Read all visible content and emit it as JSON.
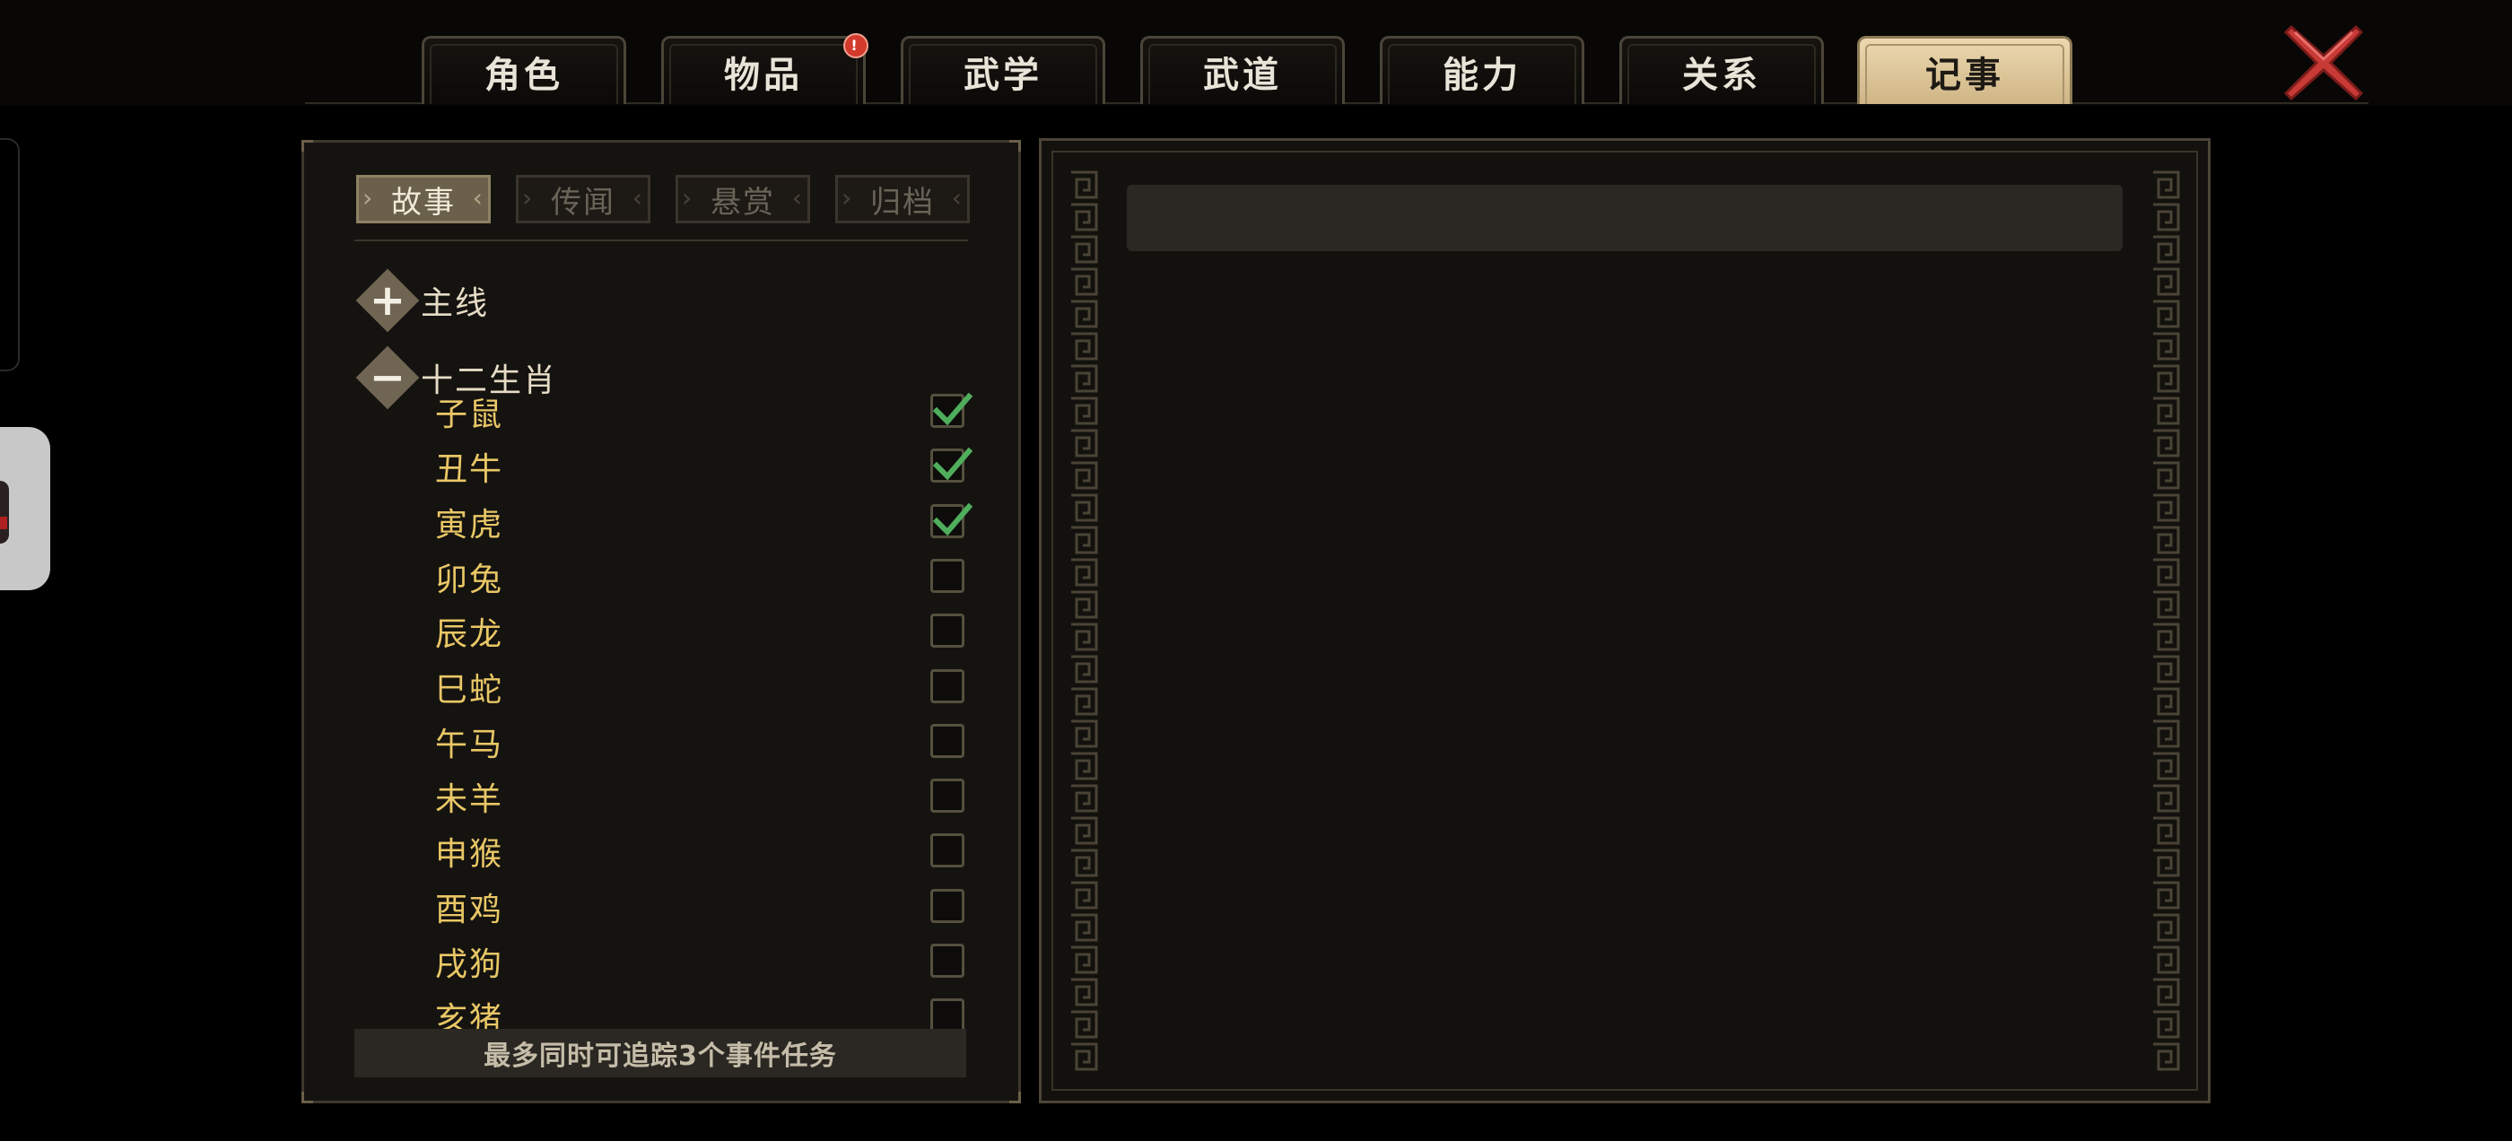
{
  "tabs": [
    {
      "label": "角色",
      "active": false
    },
    {
      "label": "物品",
      "active": false,
      "badge": "!"
    },
    {
      "label": "武学",
      "active": false
    },
    {
      "label": "武道",
      "active": false
    },
    {
      "label": "能力",
      "active": false
    },
    {
      "label": "关系",
      "active": false
    },
    {
      "label": "记事",
      "active": true
    }
  ],
  "subtabs": [
    {
      "label": "故事",
      "active": true
    },
    {
      "label": "传闻",
      "active": false
    },
    {
      "label": "悬赏",
      "active": false
    },
    {
      "label": "归档",
      "active": false
    }
  ],
  "groups": [
    {
      "label": "主线",
      "expanded": false,
      "symbol": "+"
    },
    {
      "label": "十二生肖",
      "expanded": true,
      "symbol": "−"
    }
  ],
  "zodiac_items": [
    {
      "label": "子鼠",
      "tracked": true
    },
    {
      "label": "丑牛",
      "tracked": true
    },
    {
      "label": "寅虎",
      "tracked": true
    },
    {
      "label": "卯兔",
      "tracked": false
    },
    {
      "label": "辰龙",
      "tracked": false
    },
    {
      "label": "巳蛇",
      "tracked": false
    },
    {
      "label": "午马",
      "tracked": false
    },
    {
      "label": "未羊",
      "tracked": false
    },
    {
      "label": "申猴",
      "tracked": false
    },
    {
      "label": "酉鸡",
      "tracked": false
    },
    {
      "label": "戌狗",
      "tracked": false
    },
    {
      "label": "亥猪",
      "tracked": false
    }
  ],
  "footer_note": "最多同时可追踪3个事件任务",
  "colors": {
    "accent_active_tab": "#ecd8b0",
    "item_text": "#e9c766",
    "check_green": "#4fae5c",
    "close_red": "#c83a36"
  },
  "icons": {
    "close": "close-x-icon",
    "expand": "plus-icon",
    "collapse": "minus-icon",
    "check": "checkmark-icon"
  }
}
